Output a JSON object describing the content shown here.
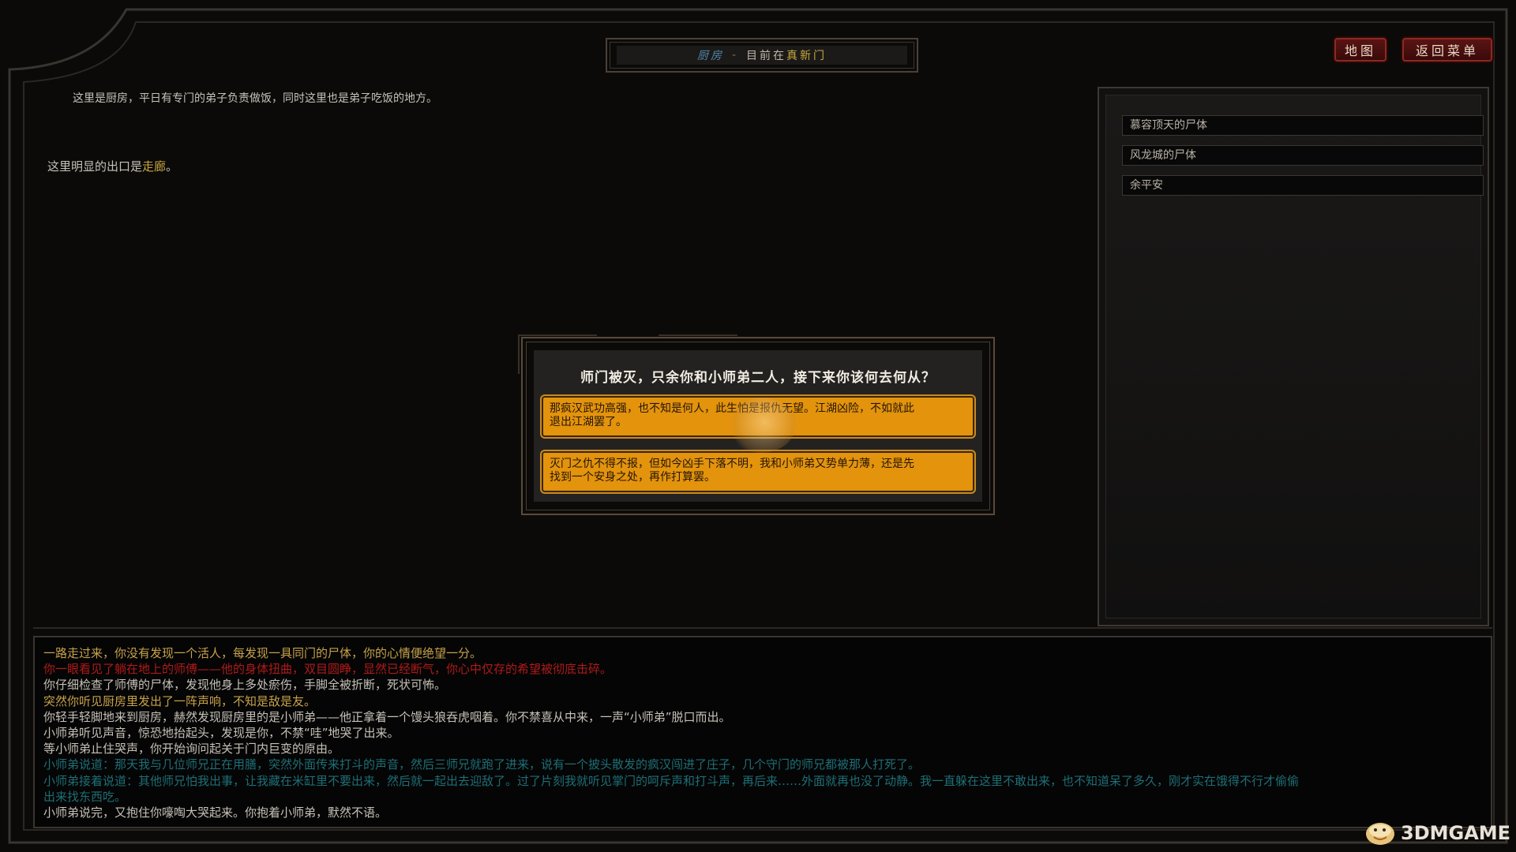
{
  "location": {
    "room": "厨房",
    "separator": "-",
    "status": "目前在",
    "sect": "真新门"
  },
  "buttons": {
    "map": "地图",
    "menu": "返回菜单"
  },
  "room": {
    "description": "这里是厨房，平日有专门的弟子负责做饭，同时这里也是弟子吃饭的地方。",
    "exits_prefix": "这里明显的出口是",
    "exit": "走廊",
    "exits_suffix": "。"
  },
  "objects": [
    "慕容顶天的尸体",
    "风龙城的尸体",
    "余平安"
  ],
  "dialog": {
    "question": "师门被灭，只余你和小师弟二人，接下来你该何去何从？",
    "choices": [
      [
        "那疯汉武功高强，也不知是何人，此生怕是报仇无望。江湖凶险，不如就此",
        "退出江湖罢了。"
      ],
      [
        "灭门之仇不得不报，但如今凶手下落不明，我和小师弟又势单力薄，还是先",
        "找到一个安身之处，再作打算罢。"
      ]
    ]
  },
  "log": [
    {
      "color": "yellow",
      "text": "一路走过来，你没有发现一个活人，每发现一具同门的尸体，你的心情便绝望一分。"
    },
    {
      "color": "red",
      "text": "你一眼看见了躺在地上的师傅——他的身体扭曲，双目圆睁，显然已经断气，你心中仅存的希望被彻底击碎。"
    },
    {
      "color": "white",
      "text": "你仔细检查了师傅的尸体，发现他身上多处瘀伤，手脚全被折断，死状可怖。"
    },
    {
      "color": "yellow",
      "text": "突然你听见厨房里发出了一阵声响，不知是敌是友。"
    },
    {
      "color": "white",
      "text": "你轻手轻脚地来到厨房，赫然发现厨房里的是小师弟——他正拿着一个馒头狼吞虎咽着。你不禁喜从中来，一声“小师弟”脱口而出。"
    },
    {
      "color": "white",
      "text": "小师弟听见声音，惊恐地抬起头，发现是你，不禁“哇”地哭了出来。"
    },
    {
      "color": "white",
      "text": "等小师弟止住哭声，你开始询问起关于门内巨变的原由。"
    },
    {
      "color": "teal",
      "text": "小师弟说道：那天我与几位师兄正在用膳，突然外面传来打斗的声音，然后三师兄就跑了进来，说有一个披头散发的疯汉闯进了庄子，几个守门的师兄都被那人打死了。"
    },
    {
      "color": "teal",
      "text": "小师弟接着说道：其他师兄怕我出事，让我藏在米缸里不要出来，然后就一起出去迎敌了。过了片刻我就听见掌门的呵斥声和打斗声，再后来……外面就再也没了动静。我一直躲在这里不敢出来，也不知道呆了多久，刚才实在饿得不行才偷偷"
    },
    {
      "color": "teal",
      "text": "出来找东西吃。"
    },
    {
      "color": "white",
      "text": "小师弟说完，又抱住你嚎啕大哭起来。你抱着小师弟，默然不语。"
    }
  ],
  "watermark": {
    "text": "3DMGAME"
  },
  "colors": {
    "highlight": "#c9a83e",
    "choice_bg": "#e3930c",
    "button_red": "#5a1414",
    "log_red": "#b01a1a",
    "log_teal": "#1d6f76"
  }
}
